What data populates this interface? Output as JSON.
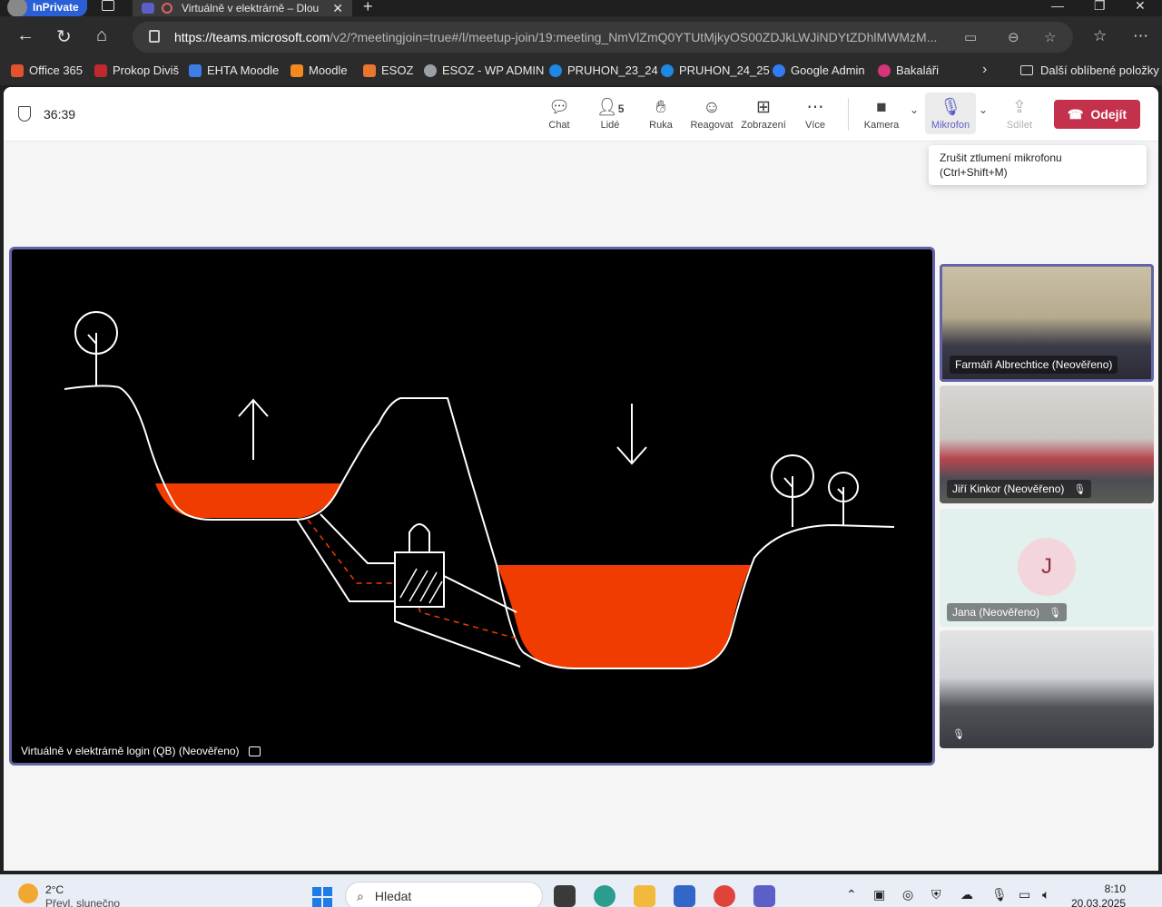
{
  "browser": {
    "inprivate_label": "InPrivate",
    "tab_title": "Virtuálně v elektrárně – Dlou",
    "url_host": "https://teams.microsoft.com",
    "url_path": "/v2/?meetingjoin=true#/l/meetup-join/19:meeting_NmVlZmQ0YTUtMjkyOS00ZDJkLWJiNDYtZDhlMWMzM..."
  },
  "bookmarks": {
    "items": [
      "Office 365",
      "Prokop Diviš",
      "EHTA Moodle",
      "Moodle",
      "ESOZ",
      "ESOZ - WP ADMIN",
      "PRUHON_23_24",
      "PRUHON_24_25",
      "Google Admin",
      "Bakaláři"
    ],
    "more_folder": "Další oblíbené položky"
  },
  "teams": {
    "timer": "36:39",
    "toolbar": {
      "chat": "Chat",
      "people": "Lidé",
      "people_count": "5",
      "hand": "Ruka",
      "react": "Reagovat",
      "view": "Zobrazení",
      "more": "Více",
      "camera": "Kamera",
      "mic": "Mikrofon",
      "share": "Sdílet",
      "leave": "Odejít"
    },
    "tooltip": {
      "line1": "Zrušit ztlumení mikrofonu",
      "line2": "(Ctrl+Shift+M)"
    },
    "stage_label": "Virtuálně v elektrárně login (QB) (Neověřeno)",
    "participants": [
      {
        "name": "Farmáři Albrechtice (Neověřeno)",
        "muted": false
      },
      {
        "name": "Jiří Kinkor (Neověřeno)",
        "muted": true
      },
      {
        "name": "Jana (Neověřeno)",
        "muted": true,
        "initial": "J"
      },
      {
        "name": "",
        "muted": true
      }
    ],
    "colors": {
      "accent": "#6264a7",
      "leave": "#c4314b",
      "water": "#f03c00"
    }
  },
  "taskbar": {
    "temp": "2°C",
    "weather": "Převl. slunečno",
    "search_placeholder": "Hledat",
    "time": "8:10",
    "date": "20.03.2025"
  }
}
